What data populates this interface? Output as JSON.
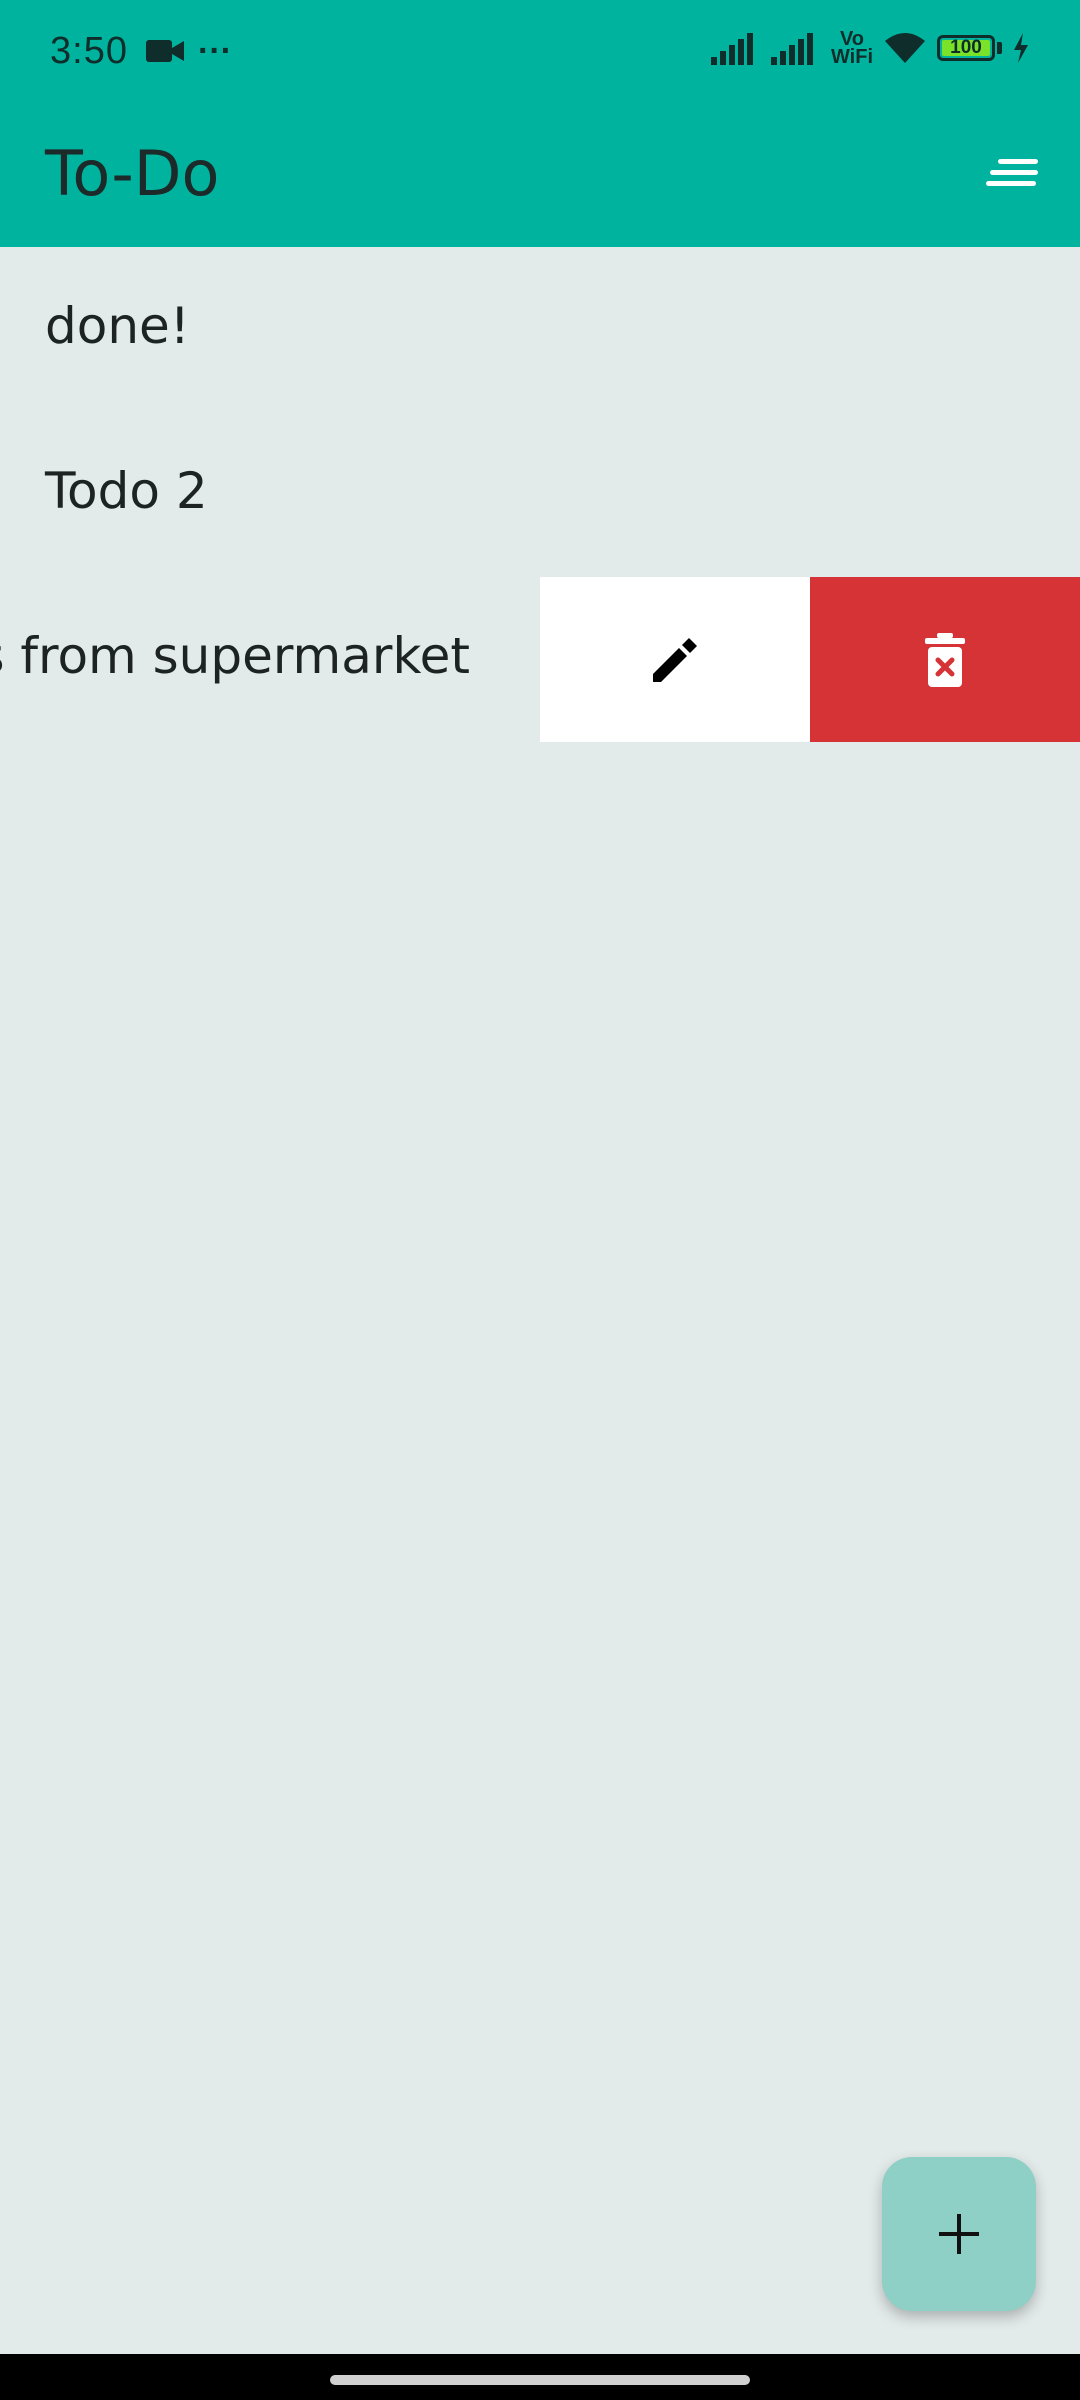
{
  "status_bar": {
    "time": "3:50",
    "more": "···",
    "vowifi_top": "Vo",
    "vowifi_bottom": "WiFi",
    "battery": "100",
    "icons": [
      "video-camera-icon",
      "signal-icon",
      "signal-icon",
      "wifi-icon",
      "battery-icon",
      "charging-icon"
    ]
  },
  "app_bar": {
    "title": "To-Do",
    "menu_icon": "sort-menu-icon"
  },
  "todos": [
    {
      "text": "done!"
    },
    {
      "text": "Todo 2"
    },
    {
      "text": "Get items from supermarket",
      "swiped": true
    }
  ],
  "swipe_actions": {
    "edit_icon": "pencil-icon",
    "delete_icon": "trash-icon",
    "delete_color": "#d63336"
  },
  "fab": {
    "icon": "plus-icon",
    "color": "#8ecfc6"
  },
  "colors": {
    "primary": "#00b39f",
    "background": "#e3ebea"
  }
}
